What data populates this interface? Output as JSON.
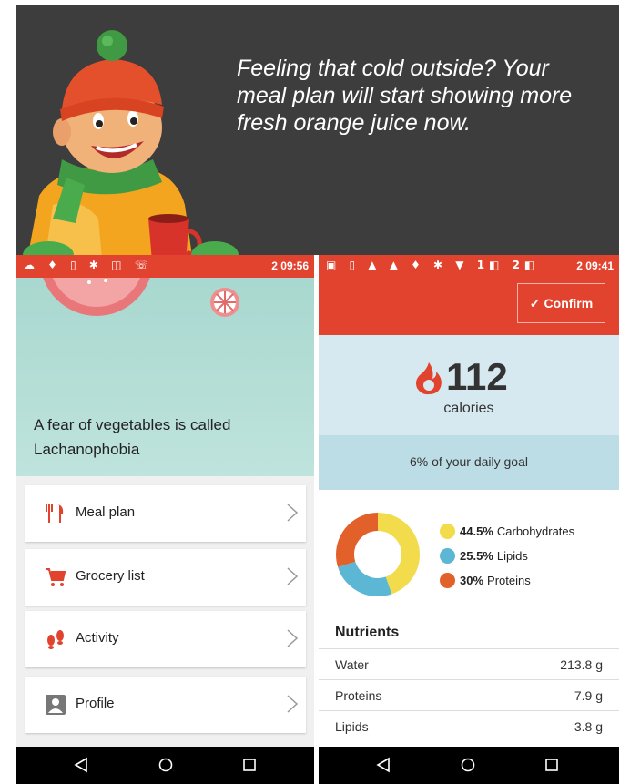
{
  "banner": {
    "tagline": "Feeling that cold outside? Your meal plan will start showing more fresh orange juice now."
  },
  "left_phone": {
    "status_time": "09:56",
    "status_battery_digit": "2",
    "fact": "A fear of vegetables is called Lachanophobia",
    "menu": [
      {
        "label": "Meal plan",
        "icon": "cutlery-icon"
      },
      {
        "label": "Grocery list",
        "icon": "cart-icon"
      },
      {
        "label": "Activity",
        "icon": "footsteps-icon"
      },
      {
        "label": "Profile",
        "icon": "person-icon"
      }
    ]
  },
  "right_phone": {
    "status_time": "09:41",
    "status_sim1": "1",
    "status_sim2": "2",
    "status_battery_digit": "2",
    "confirm_label": "Confirm",
    "calories_value": "112",
    "calories_unit": "calories",
    "daily_goal": "6% of your daily goal",
    "macros": [
      {
        "percent": "44.5%",
        "name": "Carbohydrates",
        "value": 44.5,
        "color": "#f2dc4b"
      },
      {
        "percent": "25.5%",
        "name": "Lipids",
        "value": 25.5,
        "color": "#5bb7d3"
      },
      {
        "percent": "30%",
        "name": "Proteins",
        "value": 30,
        "color": "#e2602a"
      }
    ],
    "nutrients_title": "Nutrients",
    "nutrients": [
      {
        "name": "Water",
        "value": "213.8 g"
      },
      {
        "name": "Proteins",
        "value": "7.9 g"
      },
      {
        "name": "Lipids",
        "value": "3.8 g"
      }
    ]
  },
  "colors": {
    "accent_red": "#e2432f",
    "banner_bg": "#3d3d3d",
    "teal_bg": "#a8d8cf",
    "calorie_bg": "#d6e9f0",
    "goal_bg": "#bddde6",
    "menu_icon_red": "#e2432f",
    "profile_icon_gray": "#777777"
  }
}
